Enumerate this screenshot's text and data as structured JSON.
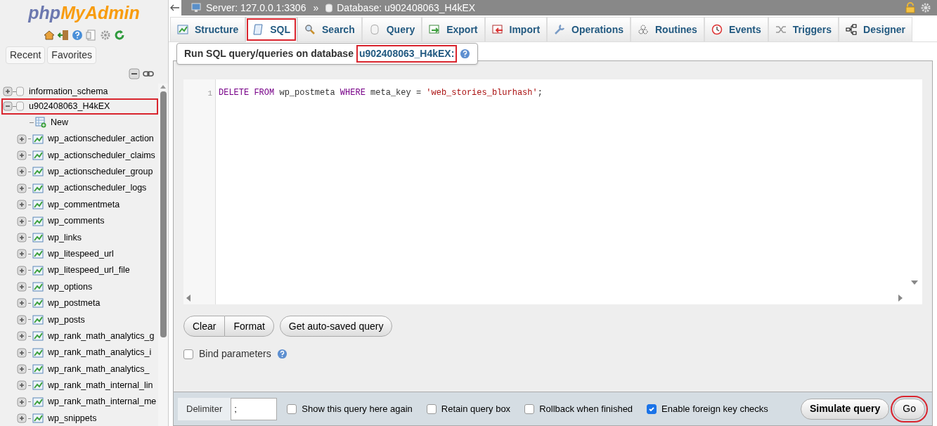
{
  "sidebar": {
    "logo": {
      "php": "php",
      "myadmin": "MyAdmin"
    },
    "tabs": [
      {
        "label": "Recent"
      },
      {
        "label": "Favorites"
      }
    ],
    "tree": [
      {
        "label": "information_schema",
        "expanded": false,
        "highlighted": false
      },
      {
        "label": "u902408063_H4kEX",
        "expanded": true,
        "highlighted": true,
        "children": [
          {
            "kind": "new",
            "label": "New"
          },
          {
            "kind": "table",
            "label": "wp_actionscheduler_action"
          },
          {
            "kind": "table",
            "label": "wp_actionscheduler_claims"
          },
          {
            "kind": "table",
            "label": "wp_actionscheduler_group"
          },
          {
            "kind": "table",
            "label": "wp_actionscheduler_logs"
          },
          {
            "kind": "table",
            "label": "wp_commentmeta"
          },
          {
            "kind": "table",
            "label": "wp_comments"
          },
          {
            "kind": "table",
            "label": "wp_links"
          },
          {
            "kind": "table",
            "label": "wp_litespeed_url"
          },
          {
            "kind": "table",
            "label": "wp_litespeed_url_file"
          },
          {
            "kind": "table",
            "label": "wp_options"
          },
          {
            "kind": "table",
            "label": "wp_postmeta"
          },
          {
            "kind": "table",
            "label": "wp_posts"
          },
          {
            "kind": "table",
            "label": "wp_rank_math_analytics_g"
          },
          {
            "kind": "table",
            "label": "wp_rank_math_analytics_i"
          },
          {
            "kind": "table",
            "label": "wp_rank_math_analytics_"
          },
          {
            "kind": "table",
            "label": "wp_rank_math_internal_lin"
          },
          {
            "kind": "table",
            "label": "wp_rank_math_internal_me"
          },
          {
            "kind": "table",
            "label": "wp_snippets"
          }
        ]
      }
    ]
  },
  "breadcrumb": {
    "server": "Server: 127.0.0.1:3306",
    "separator": "»",
    "database": "Database: u902408063_H4kEX"
  },
  "tabs": [
    {
      "label": "Structure",
      "selected": false,
      "highlighted": false
    },
    {
      "label": "SQL",
      "selected": true,
      "highlighted": true
    },
    {
      "label": "Search",
      "selected": false,
      "highlighted": false
    },
    {
      "label": "Query",
      "selected": false,
      "highlighted": false
    },
    {
      "label": "Export",
      "selected": false,
      "highlighted": false
    },
    {
      "label": "Import",
      "selected": false,
      "highlighted": false
    },
    {
      "label": "Operations",
      "selected": false,
      "highlighted": false
    },
    {
      "label": "Routines",
      "selected": false,
      "highlighted": false
    },
    {
      "label": "Events",
      "selected": false,
      "highlighted": false
    },
    {
      "label": "Triggers",
      "selected": false,
      "highlighted": false
    },
    {
      "label": "Designer",
      "selected": false,
      "highlighted": false
    }
  ],
  "query_panel": {
    "legend": "Run SQL query/queries on database",
    "database": "u902408063_H4kEX:",
    "database_highlighted": true,
    "line_number": "1",
    "sql": "DELETE FROM wp_postmeta WHERE meta_key = 'web_stories_blurhash';",
    "buttons": [
      {
        "label": "Clear"
      },
      {
        "label": "Format"
      },
      {
        "label": "Get auto-saved query"
      }
    ],
    "bind_parameters": {
      "label": "Bind parameters",
      "checked": false
    }
  },
  "footer": {
    "delimiter_label": "Delimiter",
    "delimiter_value": ";",
    "options": [
      {
        "label": "Show this query here again",
        "checked": false
      },
      {
        "label": "Retain query box",
        "checked": false
      },
      {
        "label": "Rollback when finished",
        "checked": false
      },
      {
        "label": "Enable foreign key checks",
        "checked": true
      }
    ],
    "simulate": {
      "label": "Simulate query"
    },
    "go": {
      "label": "Go",
      "highlighted": true
    }
  }
}
